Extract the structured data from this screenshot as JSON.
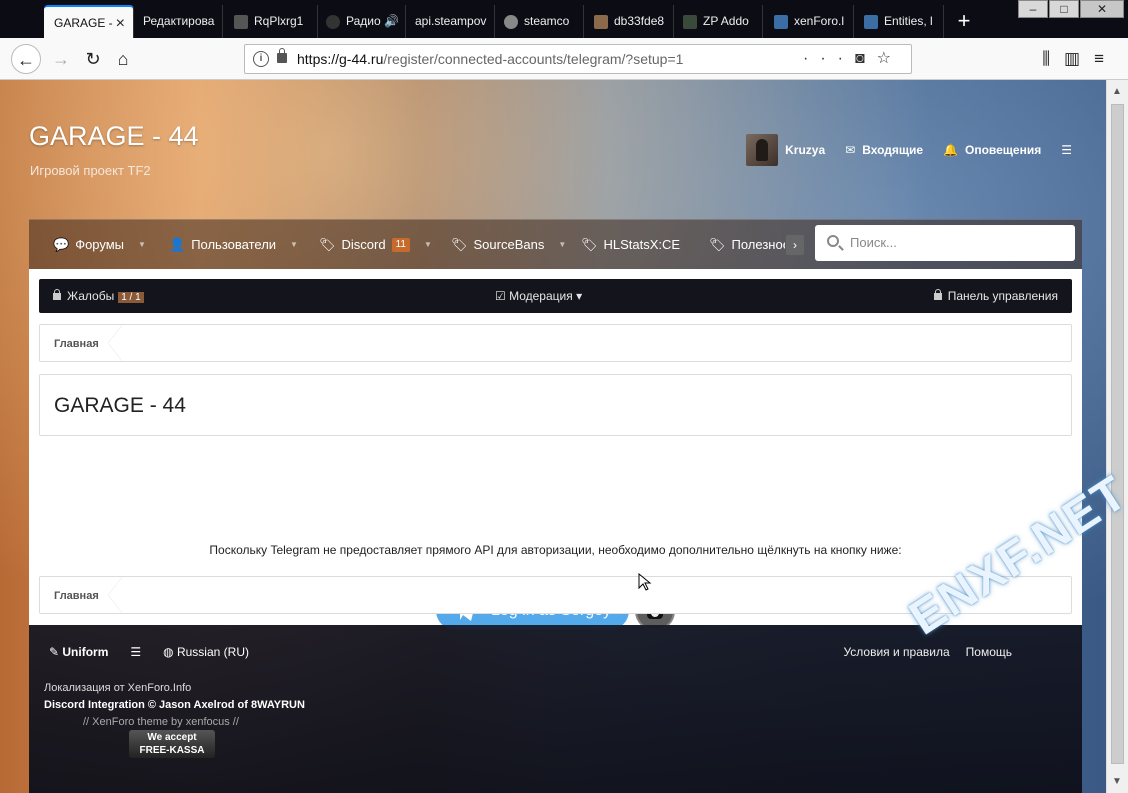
{
  "browser": {
    "tabs": [
      {
        "label": "GARAGE -",
        "active": true
      },
      {
        "label": "Редактирова"
      },
      {
        "label": "RqPlxrg1"
      },
      {
        "label": "Радио"
      },
      {
        "label": "api.steampov"
      },
      {
        "label": "steamco"
      },
      {
        "label": "db33fde8"
      },
      {
        "label": "ZP Addo"
      },
      {
        "label": "xenForo.l"
      },
      {
        "label": "Entities, l"
      }
    ],
    "url_domain": "https://g-44.ru",
    "url_path": "/register/connected-accounts/telegram/?setup=1"
  },
  "site": {
    "title": "GARAGE - 44",
    "subtitle": "Игровой проект TF2",
    "user_nav": {
      "username": "Kruzya",
      "inbox": "Входящие",
      "alerts": "Оповещения"
    },
    "nav": [
      {
        "label": "Форумы"
      },
      {
        "label": "Пользователи"
      },
      {
        "label": "Discord",
        "badge": "11"
      },
      {
        "label": "SourceBans"
      },
      {
        "label": "HLStatsX:CE"
      },
      {
        "label": "Полезное"
      }
    ],
    "search_placeholder": "Поиск..."
  },
  "modbar": {
    "reports": "Жалобы",
    "reports_badge": "1 / 1",
    "moderation": "Модерация",
    "admin": "Панель управления"
  },
  "breadcrumb": "Главная",
  "page_title": "GARAGE - 44",
  "description": "Поскольку Telegram не предоставляет прямого API для авторизации, необходимо дополнительно щёлкнуть на кнопку ниже:",
  "telegram_button": "Log in as Sergey",
  "footer": {
    "style": "Uniform",
    "language": "Russian (RU)",
    "terms": "Условия и правила",
    "help": "Помощь",
    "line1": "Локализация от XenForo.Info",
    "line2": "Discord Integration © Jason Axelrod of 8WAYRUN",
    "line3": "//     XenForo theme by xenfocus     //",
    "kassa_top": "We accept",
    "kassa_bottom": "FREE-KASSA"
  },
  "watermark": "ENXF.NET"
}
